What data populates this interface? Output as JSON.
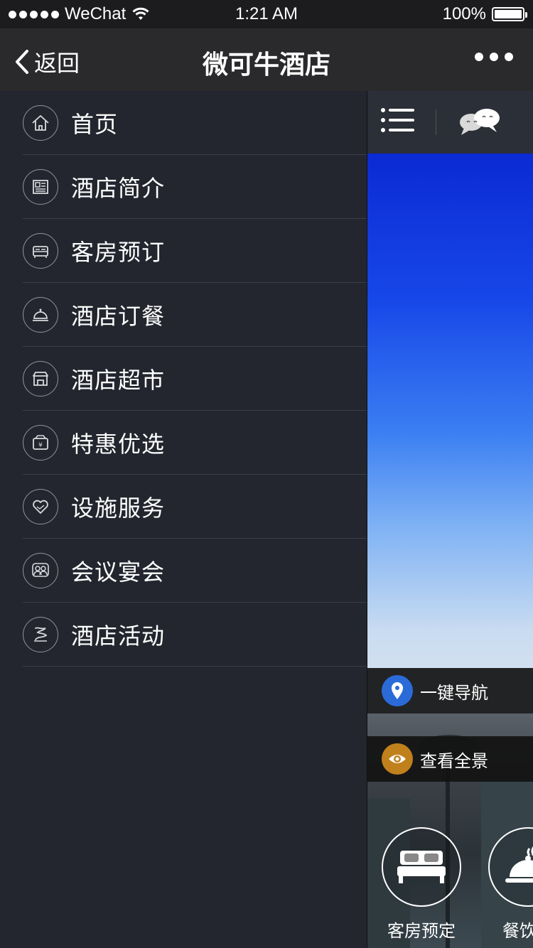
{
  "status_bar": {
    "carrier": "WeChat",
    "time": "1:21 AM",
    "battery": "100%"
  },
  "nav": {
    "back_label": "返回",
    "title": "微可牛酒店"
  },
  "menu": {
    "items": [
      {
        "label": "首页",
        "icon": "home-icon"
      },
      {
        "label": "酒店简介",
        "icon": "newspaper-icon"
      },
      {
        "label": "客房预订",
        "icon": "bed-icon"
      },
      {
        "label": "酒店订餐",
        "icon": "food-cover-icon"
      },
      {
        "label": "酒店超市",
        "icon": "store-icon"
      },
      {
        "label": "特惠优选",
        "icon": "wallet-icon"
      },
      {
        "label": "设施服务",
        "icon": "heart-icon"
      },
      {
        "label": "会议宴会",
        "icon": "people-icon"
      },
      {
        "label": "酒店活动",
        "icon": "flag-icon"
      }
    ]
  },
  "content": {
    "quick_actions": [
      {
        "label": "一键导航",
        "icon": "location-pin-icon",
        "color": "#2a6bd8"
      },
      {
        "label": "查看全景",
        "icon": "eye-icon",
        "color": "#c0801c"
      }
    ],
    "services": [
      {
        "label": "客房预定",
        "icon": "bed-icon"
      },
      {
        "label": "餐饮料",
        "icon": "food-cover-icon"
      }
    ]
  },
  "colors": {
    "menu_bg": "#23262e",
    "nav_bg": "#2a2a2c",
    "divider": "#3a3e47"
  }
}
